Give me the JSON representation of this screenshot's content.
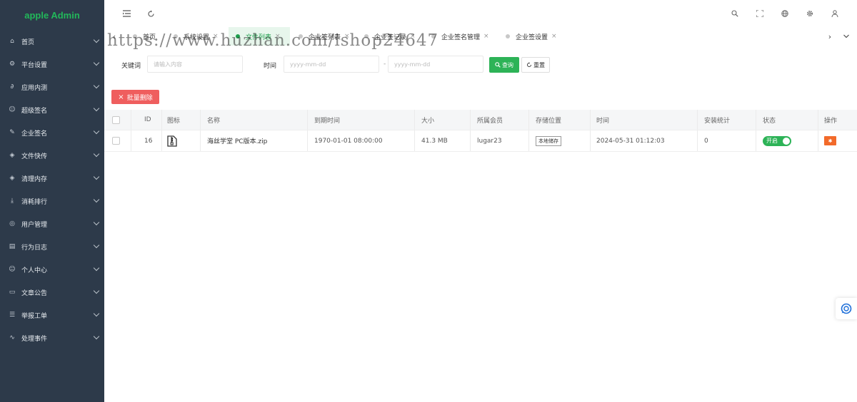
{
  "brand": "apple Admin",
  "colors": {
    "sidebar_bg": "#2d3a4a",
    "brand": "#22b85a",
    "accent": "#2db357",
    "danger": "#ef5e5e",
    "op": "#f26a2a"
  },
  "sidebar": {
    "items": [
      {
        "label": "首页",
        "icon": "home-icon"
      },
      {
        "label": "平台设置",
        "icon": "gear-icon"
      },
      {
        "label": "应用内测",
        "icon": "paperclip-icon"
      },
      {
        "label": "超级签名",
        "icon": "smile-icon"
      },
      {
        "label": "企业签名",
        "icon": "edit-icon"
      },
      {
        "label": "文件快传",
        "icon": "cube-icon"
      },
      {
        "label": "清理内存",
        "icon": "cube-icon"
      },
      {
        "label": "消耗排行",
        "icon": "download-icon"
      },
      {
        "label": "用户管理",
        "icon": "user-circle-icon"
      },
      {
        "label": "行为日志",
        "icon": "document-icon"
      },
      {
        "label": "个人中心",
        "icon": "smile-icon"
      },
      {
        "label": "文章公告",
        "icon": "monitor-icon"
      },
      {
        "label": "举报工单",
        "icon": "list-icon"
      },
      {
        "label": "处理事件",
        "icon": "activity-icon"
      }
    ]
  },
  "tabs": [
    {
      "label": "首页",
      "active": false,
      "closable": false
    },
    {
      "label": "系统设置",
      "active": false,
      "closable": true
    },
    {
      "label": "文件列表",
      "active": true,
      "closable": true
    },
    {
      "label": "企业签列表",
      "active": false,
      "closable": true
    },
    {
      "label": "企业签记录",
      "active": false,
      "closable": true
    },
    {
      "label": "企业签名管理",
      "active": false,
      "closable": true
    },
    {
      "label": "企业签设置",
      "active": false,
      "closable": true
    }
  ],
  "filters": {
    "keyword_label": "关键词",
    "keyword_placeholder": "请输入内容",
    "time_label": "时间",
    "date_from_placeholder": "yyyy-mm-dd",
    "date_sep": "-",
    "date_to_placeholder": "yyyy-mm-dd",
    "search_label": "查询",
    "reset_label": "重置"
  },
  "batch_delete_label": "批量删除",
  "table": {
    "headers": [
      "ID",
      "图标",
      "名称",
      "到期时间",
      "大小",
      "所属会员",
      "存储位置",
      "时间",
      "安装统计",
      "状态",
      "操作"
    ],
    "rows": [
      {
        "id": "16",
        "icon": "zip-file-icon",
        "name": "海丝学堂 PC版本.zip",
        "expire": "1970-01-01 08:00:00",
        "size": "41.3 MB",
        "member": "lugar23",
        "storage": "本地储存",
        "time": "2024-05-31 01:12:03",
        "installs": "0",
        "status": "开启"
      }
    ]
  },
  "watermark": "https://www.huzhan.com/ishop24647"
}
